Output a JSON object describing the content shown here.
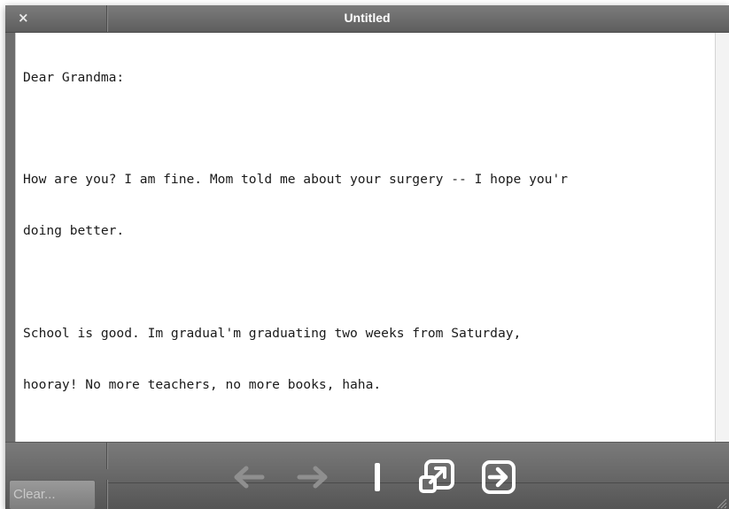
{
  "window": {
    "title": "Untitled",
    "close_icon": "×"
  },
  "editor": {
    "lines": [
      "Dear Grandma:",
      "",
      "How are you? I am fine. Mom told me about your surgery -- I hope you'r",
      "doing better.",
      "",
      "School is good. Im gradual'm graduating two weeks from Saturday,",
      "hooray! No more teachers, no more books, haha."
    ]
  },
  "toolbar": {
    "clear_label": "Clear...",
    "icons": [
      "back-arrow-icon",
      "forward-arrow-icon",
      "text-cursor-icon",
      "open-external-icon",
      "export-icon"
    ]
  },
  "colors": {
    "chrome": "#6e6e6e",
    "icon": "#ffffff",
    "icon_disabled": "#8f8f8f"
  }
}
